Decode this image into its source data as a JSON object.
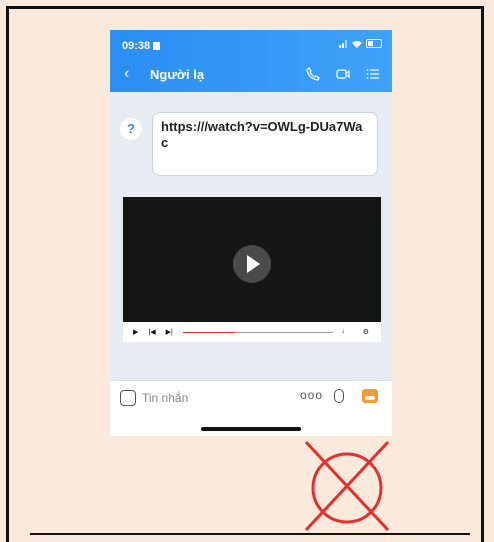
{
  "status": {
    "time": "09:38"
  },
  "header": {
    "back_icon": "chevron-left-icon",
    "title": "Người lạ"
  },
  "message": {
    "icon": "question-icon",
    "text": "https:///watch?v=OWLg-DUa7Wac"
  },
  "video": {
    "progress": 0.35
  },
  "input": {
    "placeholder": "Tin nhắn",
    "more": "ooo"
  },
  "colors": {
    "accent": "#2a8ef2",
    "mark": "#e03030"
  }
}
